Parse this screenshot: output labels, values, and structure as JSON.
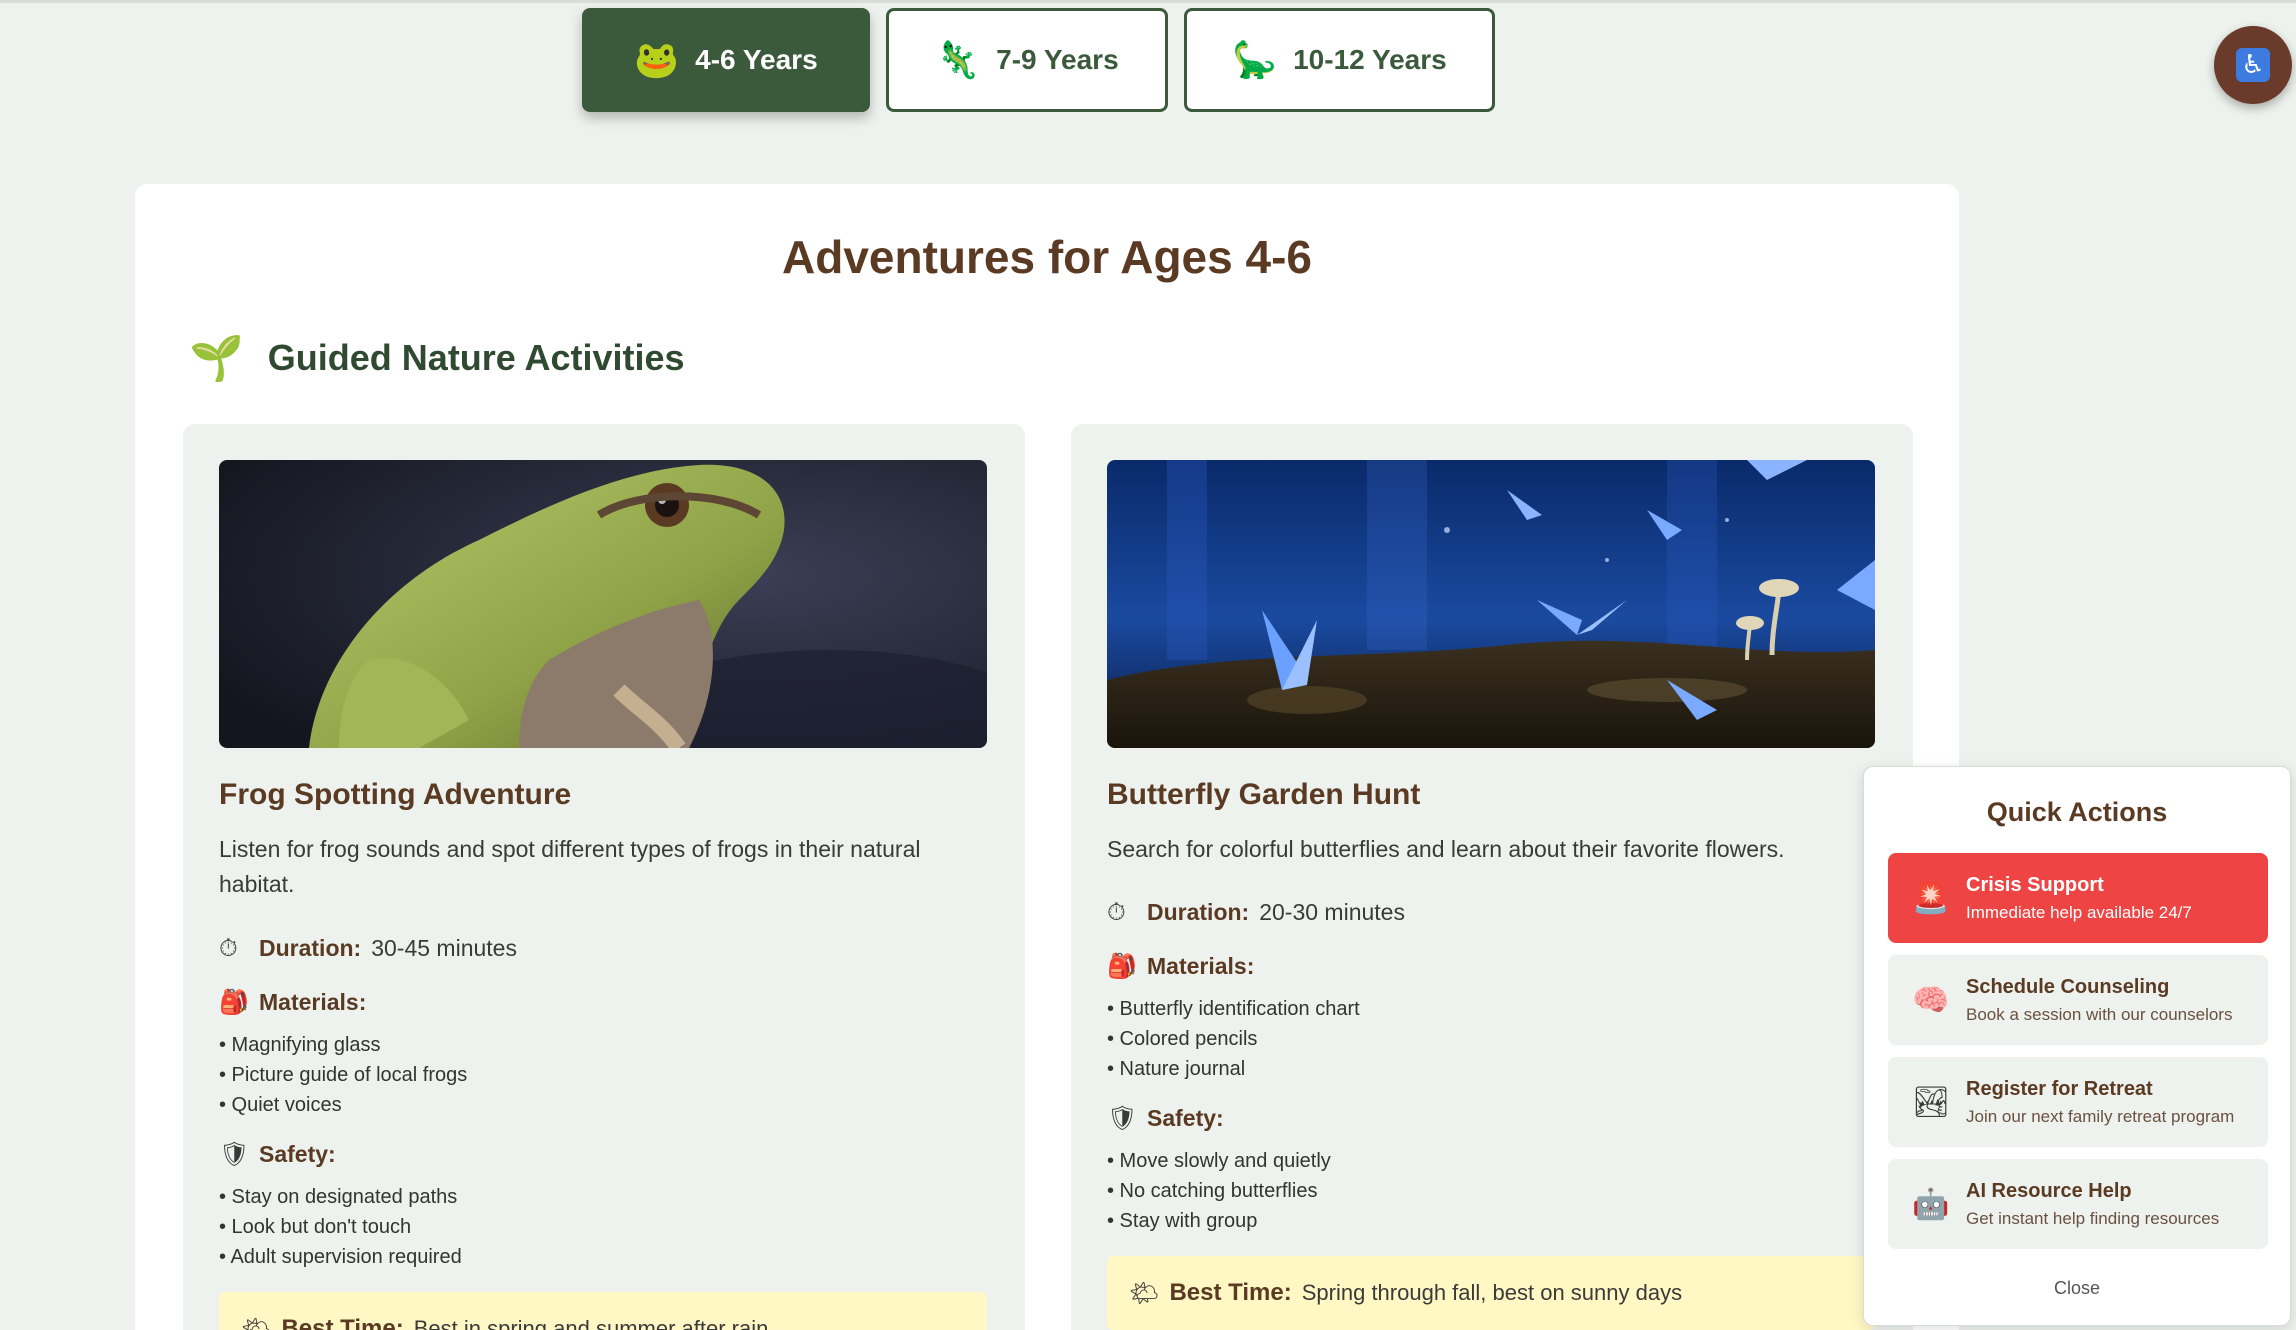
{
  "tabs": [
    {
      "emoji": "🐸",
      "label": "4-6 Years",
      "icon": "frog-icon"
    },
    {
      "emoji": "🦎",
      "label": "7-9 Years",
      "icon": "lizard-icon"
    },
    {
      "emoji": "🦕",
      "label": "10-12 Years",
      "icon": "dinosaur-icon"
    }
  ],
  "accessibility": {
    "glyph": "♿",
    "icon": "accessibility-icon"
  },
  "main": {
    "title": "Adventures for Ages 4-6",
    "section": {
      "emoji": "🌱",
      "title": "Guided Nature Activities"
    },
    "activities": [
      {
        "title": "Frog Spotting Adventure",
        "description": "Listen for frog sounds and spot different types of frogs in their natural habitat.",
        "duration_label": "Duration:",
        "duration": "30-45 minutes",
        "materials_label": "Materials:",
        "materials": [
          "• Magnifying glass",
          "• Picture guide of local frogs",
          "• Quiet voices"
        ],
        "safety_label": "Safety:",
        "safety": [
          "• Stay on designated paths",
          "• Look but don't touch",
          "• Adult supervision required"
        ],
        "best_label": "Best Time:",
        "best": "Best in spring and summer after rain"
      },
      {
        "title": "Butterfly Garden Hunt",
        "description": "Search for colorful butterflies and learn about their favorite flowers.",
        "duration_label": "Duration:",
        "duration": "20-30 minutes",
        "materials_label": "Materials:",
        "materials": [
          "• Butterfly identification chart",
          "• Colored pencils",
          "• Nature journal"
        ],
        "safety_label": "Safety:",
        "safety": [
          "• Move slowly and quietly",
          "• No catching butterflies",
          "• Stay with group"
        ],
        "best_label": "Best Time:",
        "best": "Spring through fall, best on sunny days"
      }
    ],
    "emojis": {
      "duration": "⏱",
      "materials": "🎒",
      "safety": "🛡",
      "best": "🌤"
    }
  },
  "quick_actions": {
    "title": "Quick Actions",
    "items": [
      {
        "emoji": "🚨",
        "title": "Crisis Support",
        "subtitle": "Immediate help available 24/7"
      },
      {
        "emoji": "🧠",
        "title": "Schedule Counseling",
        "subtitle": "Book a session with our counselors"
      },
      {
        "emoji": "🏞",
        "title": "Register for Retreat",
        "subtitle": "Join our next family retreat program"
      },
      {
        "emoji": "🤖",
        "title": "AI Resource Help",
        "subtitle": "Get instant help finding resources"
      }
    ],
    "close_label": "Close"
  },
  "colors": {
    "primary": "#3b5a3c",
    "brown": "#5a3a22",
    "crisis": "#ef4444",
    "best_bg": "#fff8c4"
  }
}
